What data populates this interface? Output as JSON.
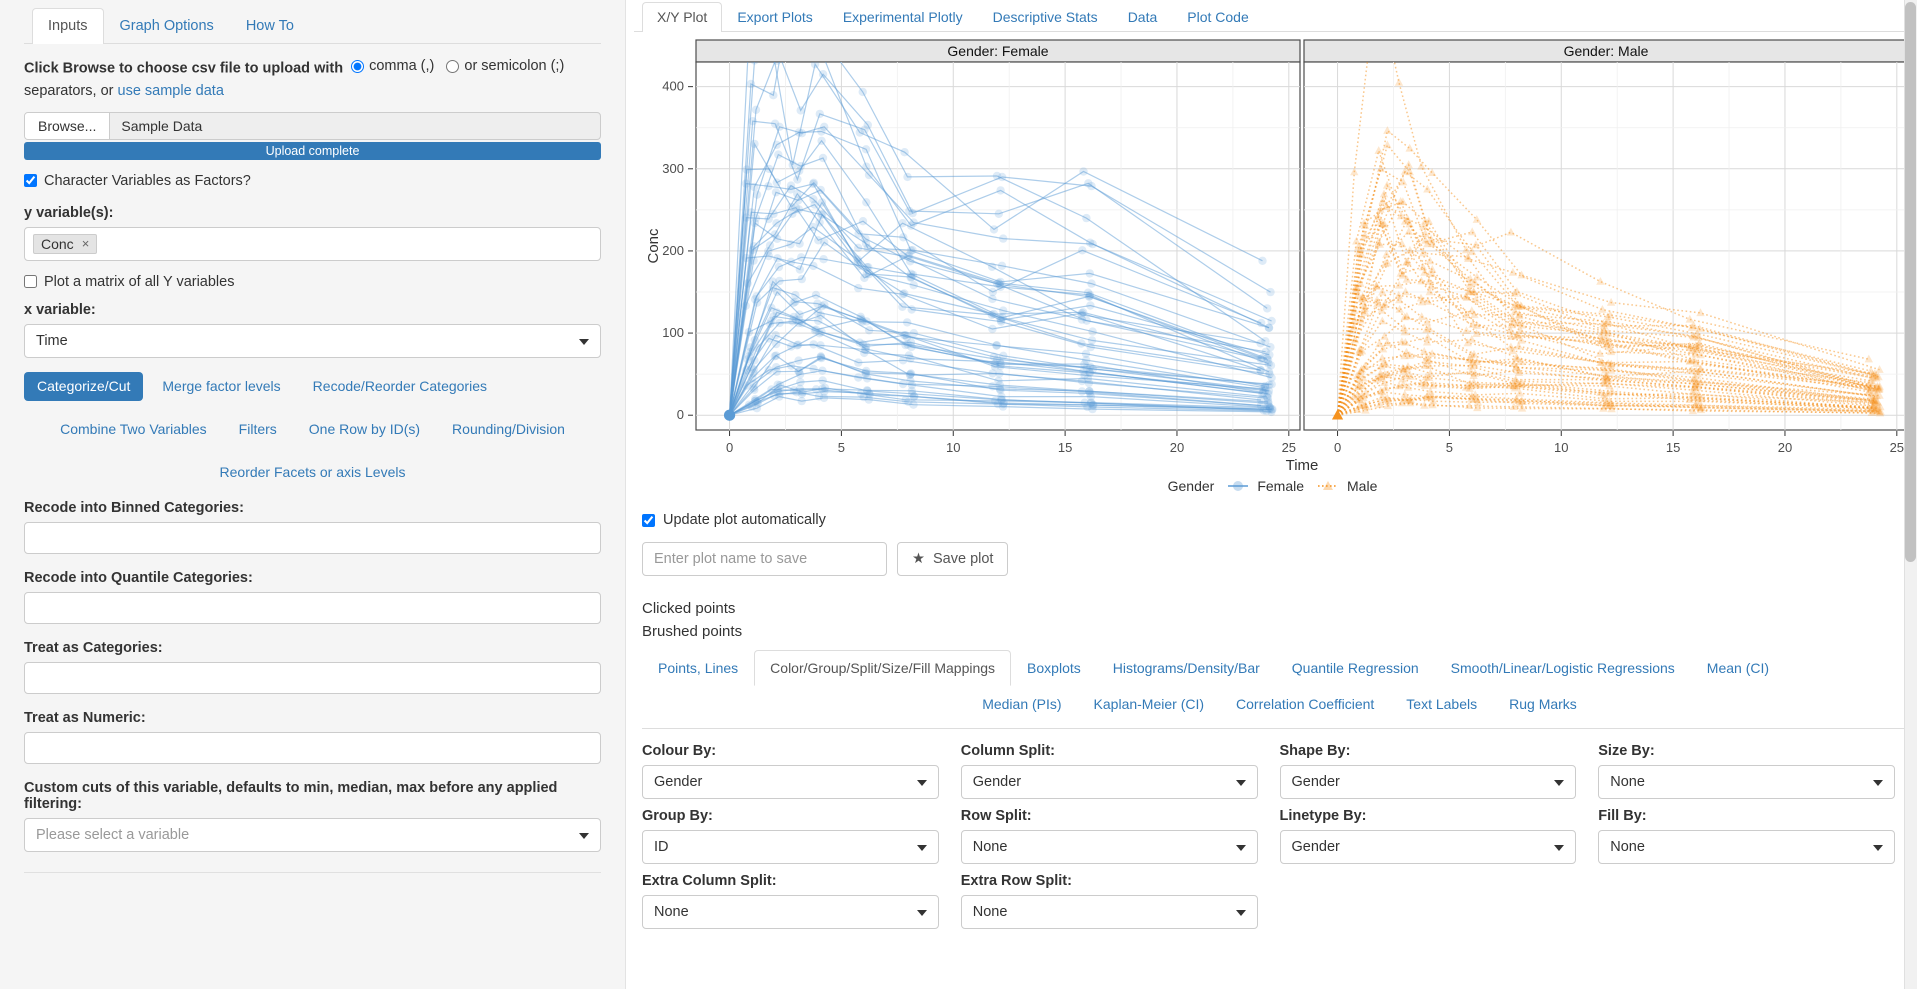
{
  "sidebar": {
    "tabs": [
      {
        "label": "Inputs",
        "active": true
      },
      {
        "label": "Graph Options",
        "active": false
      },
      {
        "label": "How To",
        "active": false
      }
    ],
    "upload": {
      "instruction_bold": "Click Browse to choose csv file to upload with",
      "radio_comma": "comma (,)",
      "radio_semicolon": "or semicolon (;)",
      "instruction_tail": "separators, or",
      "sample_link": "use sample data",
      "browse_label": "Browse...",
      "file_name": "Sample Data",
      "progress_label": "Upload complete"
    },
    "factors_checkbox": "Character Variables as Factors?",
    "y_variable_label": "y variable(s):",
    "y_variable_token": "Conc",
    "matrix_checkbox": "Plot a matrix of all Y variables",
    "x_variable_label": "x variable:",
    "x_variable_value": "Time",
    "action_pills_row1": [
      {
        "label": "Categorize/Cut",
        "active": true
      },
      {
        "label": "Merge factor levels",
        "active": false
      },
      {
        "label": "Recode/Reorder Categories",
        "active": false
      }
    ],
    "action_pills_row2": [
      {
        "label": "Combine Two Variables",
        "active": false
      },
      {
        "label": "Filters",
        "active": false
      },
      {
        "label": "One Row by ID(s)",
        "active": false
      },
      {
        "label": "Rounding/Division",
        "active": false
      }
    ],
    "action_pills_row3": [
      {
        "label": "Reorder Facets or axis Levels",
        "active": false
      }
    ],
    "binned_label": "Recode into Binned Categories:",
    "binned_value": "",
    "quantile_label": "Recode into Quantile Categories:",
    "quantile_value": "",
    "categories_label": "Treat as Categories:",
    "categories_value": "",
    "numeric_label": "Treat as Numeric:",
    "numeric_value": "",
    "customcuts_label": "Custom cuts of this variable, defaults to min, median, max before any applied filtering:",
    "customcuts_placeholder": "Please select a variable"
  },
  "main": {
    "tabs": [
      {
        "label": "X/Y Plot",
        "active": true
      },
      {
        "label": "Export Plots",
        "active": false
      },
      {
        "label": "Experimental Plotly",
        "active": false
      },
      {
        "label": "Descriptive Stats",
        "active": false
      },
      {
        "label": "Data",
        "active": false
      },
      {
        "label": "Plot Code",
        "active": false
      }
    ],
    "update_checkbox": "Update plot automatically",
    "save_placeholder": "Enter plot name to save",
    "save_value": "",
    "save_button": "Save plot",
    "star_icon": "star-icon",
    "clicked_points_label": "Clicked points",
    "brushed_points_label": "Brushed points",
    "option_tabs_row1": [
      {
        "label": "Points, Lines",
        "active": false
      },
      {
        "label": "Color/Group/Split/Size/Fill Mappings",
        "active": true
      },
      {
        "label": "Boxplots",
        "active": false
      },
      {
        "label": "Histograms/Density/Bar",
        "active": false
      },
      {
        "label": "Quantile Regression",
        "active": false
      },
      {
        "label": "Smooth/Linear/Logistic Regressions",
        "active": false
      },
      {
        "label": "Mean (CI)",
        "active": false
      }
    ],
    "option_tabs_row2": [
      {
        "label": "Median (PIs)",
        "active": false
      },
      {
        "label": "Kaplan-Meier (CI)",
        "active": false
      },
      {
        "label": "Correlation Coefficient",
        "active": false
      },
      {
        "label": "Text Labels",
        "active": false
      },
      {
        "label": "Rug Marks",
        "active": false
      }
    ],
    "mappings": [
      {
        "label": "Colour By:",
        "value": "Gender"
      },
      {
        "label": "Column Split:",
        "value": "Gender"
      },
      {
        "label": "Shape By:",
        "value": "Gender"
      },
      {
        "label": "Size By:",
        "value": "None"
      },
      {
        "label": "Group By:",
        "value": "ID"
      },
      {
        "label": "Row Split:",
        "value": "None"
      },
      {
        "label": "Linetype By:",
        "value": "Gender"
      },
      {
        "label": "Fill By:",
        "value": "None"
      },
      {
        "label": "Extra Column Split:",
        "value": "None"
      },
      {
        "label": "Extra Row Split:",
        "value": "None"
      }
    ]
  },
  "chart_data": {
    "type": "line",
    "title": "",
    "xlabel": "Time",
    "ylabel": "Conc",
    "xlim": [
      -1.5,
      25.5
    ],
    "ylim": [
      -18,
      430
    ],
    "xticks": [
      0,
      5,
      10,
      15,
      20,
      25
    ],
    "yticks": [
      0,
      100,
      200,
      300,
      400
    ],
    "grid": true,
    "legend": {
      "title": "Gender",
      "position": "bottom",
      "entries": [
        {
          "name": "Female",
          "color": "#5B9BD5",
          "linetype": "solid",
          "shape": "circle"
        },
        {
          "name": "Male",
          "color": "#F5921E",
          "linetype": "dotted",
          "shape": "triangle"
        }
      ]
    },
    "facets": [
      {
        "strip": "Gender: Female",
        "panel": "left",
        "color": "#5B9BD5",
        "linetype": "solid",
        "marker": "circle",
        "n_profiles": 48
      },
      {
        "strip": "Gender: Male",
        "panel": "right",
        "color": "#F5921E",
        "linetype": "dotted",
        "marker": "triangle",
        "n_profiles": 52
      }
    ],
    "observation_times": [
      0,
      1,
      2,
      3,
      4,
      6,
      8,
      12,
      16,
      24
    ],
    "series": [
      {
        "name": "Female",
        "facet": "Gender: Female",
        "representative_profiles": [
          {
            "x": [
              0,
              1,
              2,
              3,
              4,
              6,
              8,
              12,
              16,
              24
            ],
            "y": [
              0,
              350,
              330,
              352,
              400,
              268,
              230,
              200,
              155,
              75
            ]
          },
          {
            "x": [
              0,
              1,
              2,
              3,
              4,
              6,
              8,
              12,
              16,
              24
            ],
            "y": [
              0,
              305,
              310,
              265,
              285,
              268,
              218,
              198,
              208,
              130
            ]
          },
          {
            "x": [
              0,
              1,
              2,
              3,
              4,
              6,
              8,
              12,
              16,
              24
            ],
            "y": [
              0,
              240,
              265,
              258,
              262,
              265,
              200,
              170,
              152,
              95
            ]
          },
          {
            "x": [
              0,
              1,
              2,
              3,
              4,
              6,
              8,
              12,
              16,
              24
            ],
            "y": [
              0,
              195,
              228,
              220,
              230,
              185,
              175,
              128,
              118,
              62
            ]
          },
          {
            "x": [
              0,
              1,
              2,
              3,
              4,
              6,
              8,
              12,
              16,
              24
            ],
            "y": [
              0,
              160,
              205,
              188,
              195,
              160,
              150,
              120,
              105,
              55
            ]
          },
          {
            "x": [
              0,
              1,
              2,
              3,
              4,
              6,
              8,
              12,
              16,
              24
            ],
            "y": [
              0,
              120,
              175,
              165,
              170,
              140,
              120,
              95,
              85,
              45
            ]
          },
          {
            "x": [
              0,
              1,
              2,
              3,
              4,
              6,
              8,
              12,
              16,
              24
            ],
            "y": [
              0,
              95,
              140,
              138,
              145,
              115,
              100,
              78,
              68,
              35
            ]
          },
          {
            "x": [
              0,
              1,
              2,
              3,
              4,
              6,
              8,
              12,
              16,
              24
            ],
            "y": [
              0,
              70,
              110,
              105,
              112,
              92,
              80,
              60,
              52,
              28
            ]
          },
          {
            "x": [
              0,
              1,
              2,
              3,
              4,
              6,
              8,
              12,
              16,
              24
            ],
            "y": [
              0,
              50,
              85,
              82,
              88,
              70,
              62,
              48,
              40,
              20
            ]
          },
          {
            "x": [
              0,
              1,
              2,
              3,
              4,
              6,
              8,
              12,
              16,
              24
            ],
            "y": [
              0,
              35,
              60,
              58,
              62,
              52,
              45,
              34,
              28,
              14
            ]
          },
          {
            "x": [
              0,
              1,
              2,
              3,
              4,
              6,
              8,
              12,
              16,
              24
            ],
            "y": [
              0,
              22,
              42,
              40,
              44,
              36,
              30,
              23,
              19,
              9
            ]
          },
          {
            "x": [
              0,
              1,
              2,
              3,
              4,
              6,
              8,
              12,
              16,
              24
            ],
            "y": [
              0,
              12,
              25,
              24,
              26,
              21,
              18,
              14,
              11,
              5
            ]
          }
        ]
      },
      {
        "name": "Male",
        "facet": "Gender: Male",
        "representative_profiles": [
          {
            "x": [
              0,
              1,
              2,
              3,
              4,
              6,
              8,
              12,
              16,
              24
            ],
            "y": [
              0,
              210,
              330,
              270,
              245,
              165,
              130,
              95,
              85,
              40
            ]
          },
          {
            "x": [
              0,
              1,
              2,
              3,
              4,
              6,
              8,
              12,
              16,
              24
            ],
            "y": [
              0,
              168,
              215,
              230,
              218,
              160,
              122,
              92,
              80,
              38
            ]
          },
          {
            "x": [
              0,
              1,
              2,
              3,
              4,
              6,
              8,
              12,
              16,
              24
            ],
            "y": [
              0,
              150,
              195,
              205,
              180,
              150,
              115,
              88,
              75,
              35
            ]
          },
          {
            "x": [
              0,
              1,
              2,
              3,
              4,
              6,
              8,
              12,
              16,
              24
            ],
            "y": [
              0,
              130,
              170,
              165,
              160,
              130,
              108,
              82,
              70,
              32
            ]
          },
          {
            "x": [
              0,
              1,
              2,
              3,
              4,
              6,
              8,
              12,
              16,
              24
            ],
            "y": [
              0,
              110,
              145,
              145,
              140,
              118,
              100,
              78,
              66,
              30
            ]
          },
          {
            "x": [
              0,
              1,
              2,
              3,
              4,
              6,
              8,
              12,
              16,
              24
            ],
            "y": [
              0,
              90,
              120,
              122,
              118,
              100,
              92,
              72,
              60,
              28
            ]
          },
          {
            "x": [
              0,
              1,
              2,
              3,
              4,
              6,
              8,
              12,
              16,
              24
            ],
            "y": [
              0,
              72,
              100,
              100,
              98,
              85,
              78,
              62,
              52,
              24
            ]
          },
          {
            "x": [
              0,
              1,
              2,
              3,
              4,
              6,
              8,
              12,
              16,
              24
            ],
            "y": [
              0,
              55,
              80,
              82,
              80,
              70,
              64,
              52,
              44,
              20
            ]
          },
          {
            "x": [
              0,
              1,
              2,
              3,
              4,
              6,
              8,
              12,
              16,
              24
            ],
            "y": [
              0,
              40,
              60,
              62,
              60,
              52,
              48,
              40,
              33,
              15
            ]
          },
          {
            "x": [
              0,
              1,
              2,
              3,
              4,
              6,
              8,
              12,
              16,
              24
            ],
            "y": [
              0,
              28,
              44,
              45,
              44,
              38,
              35,
              28,
              24,
              11
            ]
          },
          {
            "x": [
              0,
              1,
              2,
              3,
              4,
              6,
              8,
              12,
              16,
              24
            ],
            "y": [
              0,
              18,
              30,
              31,
              30,
              26,
              24,
              19,
              16,
              7
            ]
          },
          {
            "x": [
              0,
              1,
              2,
              3,
              4,
              6,
              8,
              12,
              16,
              24
            ],
            "y": [
              0,
              10,
              18,
              18,
              18,
              15,
              14,
              11,
              9,
              4
            ]
          }
        ]
      }
    ]
  }
}
